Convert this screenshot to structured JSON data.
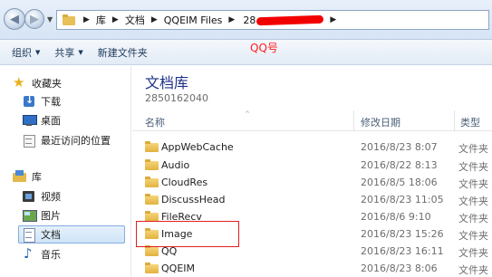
{
  "address": {
    "back_arrow": "◀",
    "fwd_arrow": "▶",
    "crumbs": [
      "库",
      "文档",
      "QQEIM Files"
    ],
    "redacted_prefix": "28",
    "separator": "▶"
  },
  "annotation": {
    "qq_label": "QQ号",
    "color": "#ff2020"
  },
  "toolbar": {
    "organize": "组织",
    "share": "共享",
    "new_folder": "新建文件夹",
    "caret": "▼"
  },
  "sidebar": {
    "favorites": {
      "title": "收藏夹",
      "items": [
        "下载",
        "桌面",
        "最近访问的位置"
      ]
    },
    "libraries": {
      "title": "库",
      "items": [
        "视频",
        "图片",
        "文档",
        "音乐"
      ],
      "selected": "文档"
    }
  },
  "main": {
    "library_title": "文档库",
    "library_subtitle": "2850162040",
    "columns": {
      "name": "名称",
      "modified": "修改日期",
      "type": "类型",
      "sort_glyph": "^"
    },
    "rows": [
      {
        "name": "AppWebCache",
        "date": "2016/8/23 8:07",
        "type": "文件夹"
      },
      {
        "name": "Audio",
        "date": "2016/8/22 8:13",
        "type": "文件夹"
      },
      {
        "name": "CloudRes",
        "date": "2016/8/5 18:06",
        "type": "文件夹"
      },
      {
        "name": "DiscussHead",
        "date": "2016/8/23 11:05",
        "type": "文件夹"
      },
      {
        "name": "FileRecv",
        "date": "2016/8/6 9:10",
        "type": "文件夹"
      },
      {
        "name": "Image",
        "date": "2016/8/23 15:26",
        "type": "文件夹"
      },
      {
        "name": "QQ",
        "date": "2016/8/23 16:11",
        "type": "文件夹"
      },
      {
        "name": "QQEIM",
        "date": "2016/8/23 8:06",
        "type": "文件夹"
      }
    ],
    "highlighted_row": "Image"
  }
}
